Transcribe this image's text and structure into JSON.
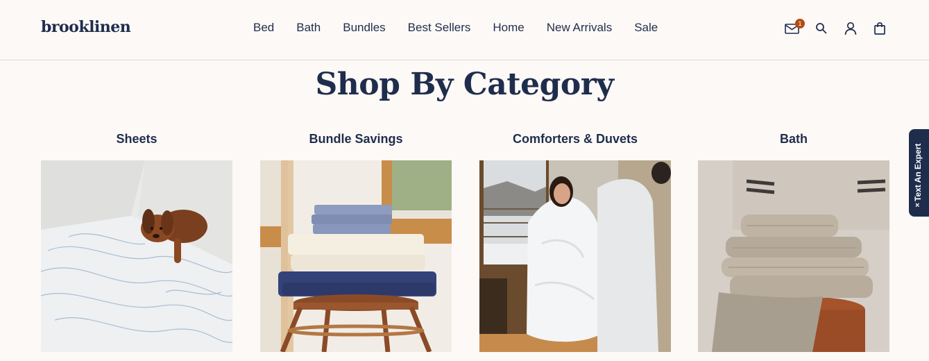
{
  "header": {
    "logo": "brooklinen",
    "nav": [
      "Bed",
      "Bath",
      "Bundles",
      "Best Sellers",
      "Home",
      "New Arrivals",
      "Sale"
    ],
    "icons": {
      "mail": "mail-icon",
      "mail_badge": "1",
      "search": "search-icon",
      "account": "user-icon",
      "cart": "bag-icon"
    }
  },
  "main": {
    "title": "Shop By Category",
    "categories": [
      {
        "label": "Sheets",
        "image": "sheets-image"
      },
      {
        "label": "Bundle Savings",
        "image": "bundle-savings-image"
      },
      {
        "label": "Comforters & Duvets",
        "image": "comforters-image"
      },
      {
        "label": "Bath",
        "image": "bath-image"
      }
    ]
  },
  "widget": {
    "label": "Text An Expert",
    "close": "×"
  },
  "colors": {
    "navy": "#1f2d4d",
    "background": "#fdf9f6",
    "badge": "#b24b12"
  }
}
